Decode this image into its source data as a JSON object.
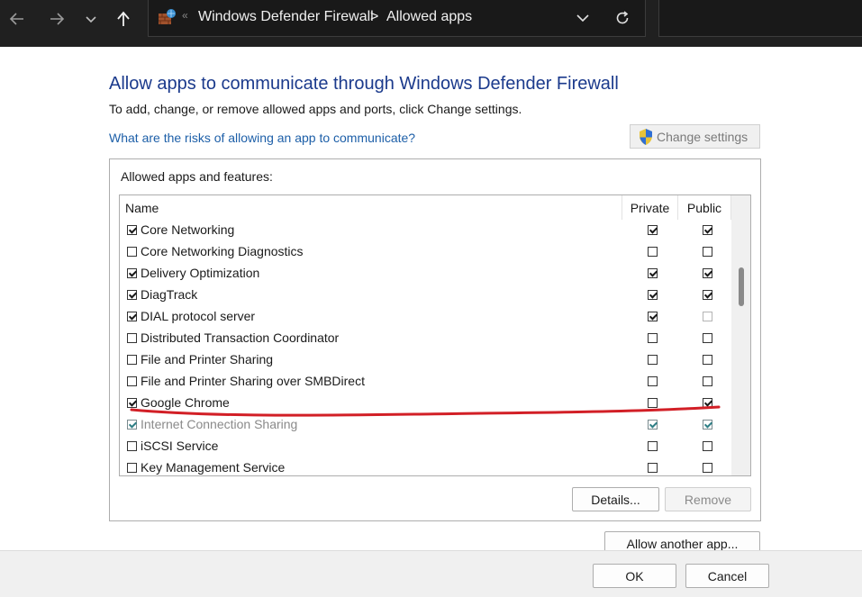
{
  "addressbar": {
    "crumbs": [
      "Windows Defender Firewall",
      "Allowed apps"
    ],
    "crumb_separator": ">",
    "overflow_marker": "«"
  },
  "header": {
    "title": "Allow apps to communicate through Windows Defender Firewall",
    "subtitle": "To add, change, or remove allowed apps and ports, click Change settings.",
    "risk_link": "What are the risks of allowing an app to communicate?",
    "change_settings_label": "Change settings"
  },
  "apps": {
    "group_label": "Allowed apps and features:",
    "columns": {
      "name": "Name",
      "private": "Private",
      "public": "Public"
    },
    "rows": [
      {
        "name": "Core Networking",
        "enabled": true,
        "private": true,
        "public": true
      },
      {
        "name": "Core Networking Diagnostics",
        "enabled": false,
        "private": false,
        "public": false
      },
      {
        "name": "Delivery Optimization",
        "enabled": true,
        "private": true,
        "public": true
      },
      {
        "name": "DiagTrack",
        "enabled": true,
        "private": true,
        "public": true
      },
      {
        "name": "DIAL protocol server",
        "enabled": true,
        "private": true,
        "public": false,
        "public_disabled": true
      },
      {
        "name": "Distributed Transaction Coordinator",
        "enabled": false,
        "private": false,
        "public": false
      },
      {
        "name": "File and Printer Sharing",
        "enabled": false,
        "private": false,
        "public": false
      },
      {
        "name": "File and Printer Sharing over SMBDirect",
        "enabled": false,
        "private": false,
        "public": false
      },
      {
        "name": "Google Chrome",
        "enabled": true,
        "private": false,
        "public": true,
        "highlighted": true
      },
      {
        "name": "Internet Connection Sharing",
        "enabled": true,
        "private": true,
        "public": true,
        "dimmed": true
      },
      {
        "name": "iSCSI Service",
        "enabled": false,
        "private": false,
        "public": false
      },
      {
        "name": "Key Management Service",
        "enabled": false,
        "private": false,
        "public": false
      }
    ],
    "details_label": "Details...",
    "remove_label": "Remove"
  },
  "actions": {
    "allow_another_label": "Allow another app...",
    "ok_label": "OK",
    "cancel_label": "Cancel"
  },
  "colors": {
    "title": "#1b3a8c",
    "link": "#1d5fa8",
    "annotation": "#d21f26",
    "topbar": "#202020"
  }
}
